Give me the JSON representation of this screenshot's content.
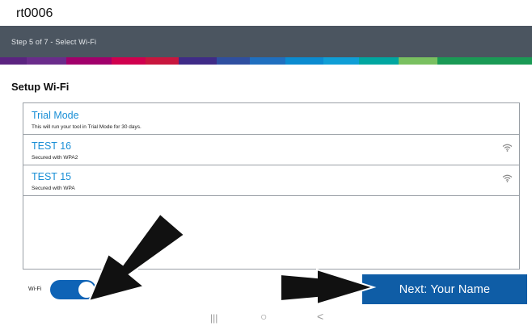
{
  "window": {
    "title": "rt0006"
  },
  "wizard": {
    "step_text": "Step 5 of 7 - Select Wi-Fi"
  },
  "colors": {
    "stripe": [
      "#5b2380",
      "#6a2c8b",
      "#a1006b",
      "#d0004e",
      "#c8163e",
      "#3f2b87",
      "#2f4fa0",
      "#1f6fbf",
      "#0b8bd0",
      "#0f9ed6",
      "#00a6a0",
      "#79c060",
      "#1a9a55"
    ],
    "accent": "#1a8fd6",
    "primary_button": "#0f5da6"
  },
  "page": {
    "heading": "Setup Wi-Fi"
  },
  "networks": [
    {
      "name": "Trial Mode",
      "description": "This will run your tool in Trial Mode for 30 days.",
      "icon": ""
    },
    {
      "name": "TEST 16",
      "description": "Secured with WPA2",
      "icon": "wifi-signal-icon"
    },
    {
      "name": "TEST 15",
      "description": "Secured with WPA",
      "icon": "wifi-signal-icon"
    }
  ],
  "wifi_toggle": {
    "label": "Wi-Fi",
    "state": "on"
  },
  "buttons": {
    "next": "Next: Your Name"
  },
  "android_nav": {
    "recents": "|||",
    "home": "○",
    "back": "<"
  }
}
